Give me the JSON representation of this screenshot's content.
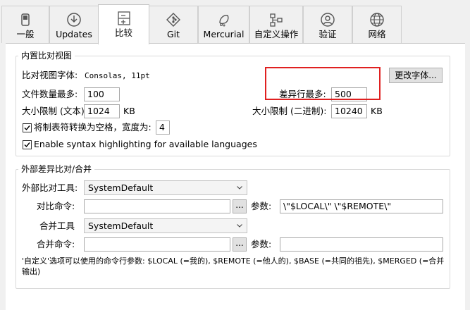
{
  "tabs": [
    {
      "label": "一般",
      "icon": "switch-icon"
    },
    {
      "label": "Updates",
      "icon": "download-icon"
    },
    {
      "label": "比较",
      "icon": "diff-icon",
      "active": true
    },
    {
      "label": "Git",
      "icon": "git-icon"
    },
    {
      "label": "Mercurial",
      "icon": "mercurial-icon"
    },
    {
      "label": "自定义操作",
      "icon": "workflow-icon"
    },
    {
      "label": "验证",
      "icon": "user-icon"
    },
    {
      "label": "网络",
      "icon": "globe-icon"
    }
  ],
  "builtin": {
    "title": "内置比对视图",
    "font_label": "比对视图字体:",
    "font_value": "Consolas, 11pt",
    "change_font_button": "更改字体...",
    "max_files_label": "文件数量最多:",
    "max_files_value": "100",
    "max_diff_lines_label": "差异行最多:",
    "max_diff_lines_value": "500",
    "size_text_label": "大小限制 (文本)",
    "size_text_value": "1024",
    "size_text_unit": "KB",
    "size_binary_label": "大小限制 (二进制):",
    "size_binary_value": "10240",
    "size_binary_unit": "KB",
    "tabs_to_spaces_label": "将制表符转换为空格，宽度为:",
    "tabs_to_spaces_checked": true,
    "tab_width_value": "4",
    "syntax_highlight_label": "Enable syntax highlighting for available languages",
    "syntax_highlight_checked": true
  },
  "external": {
    "title": "外部差异比对/合并",
    "diff_tool_label": "外部比对工具:",
    "diff_tool_value": "SystemDefault",
    "diff_cmd_label": "对比命令:",
    "diff_cmd_value": "",
    "browse_label": "...",
    "params_label": "参数:",
    "diff_params_value": "\\\"$LOCAL\\\" \\\"$REMOTE\\\"",
    "merge_tool_label": "合并工具",
    "merge_tool_value": "SystemDefault",
    "merge_cmd_label": "合并命令:",
    "merge_cmd_value": "",
    "merge_params_value": "",
    "note": "'自定义'选项可以使用的命令行参数: $LOCAL (=我的), $REMOTE (=他人的), $BASE (=共同的祖先), $MERGED (=合并输出)"
  },
  "colors": {
    "highlight_box": "#e02020"
  }
}
